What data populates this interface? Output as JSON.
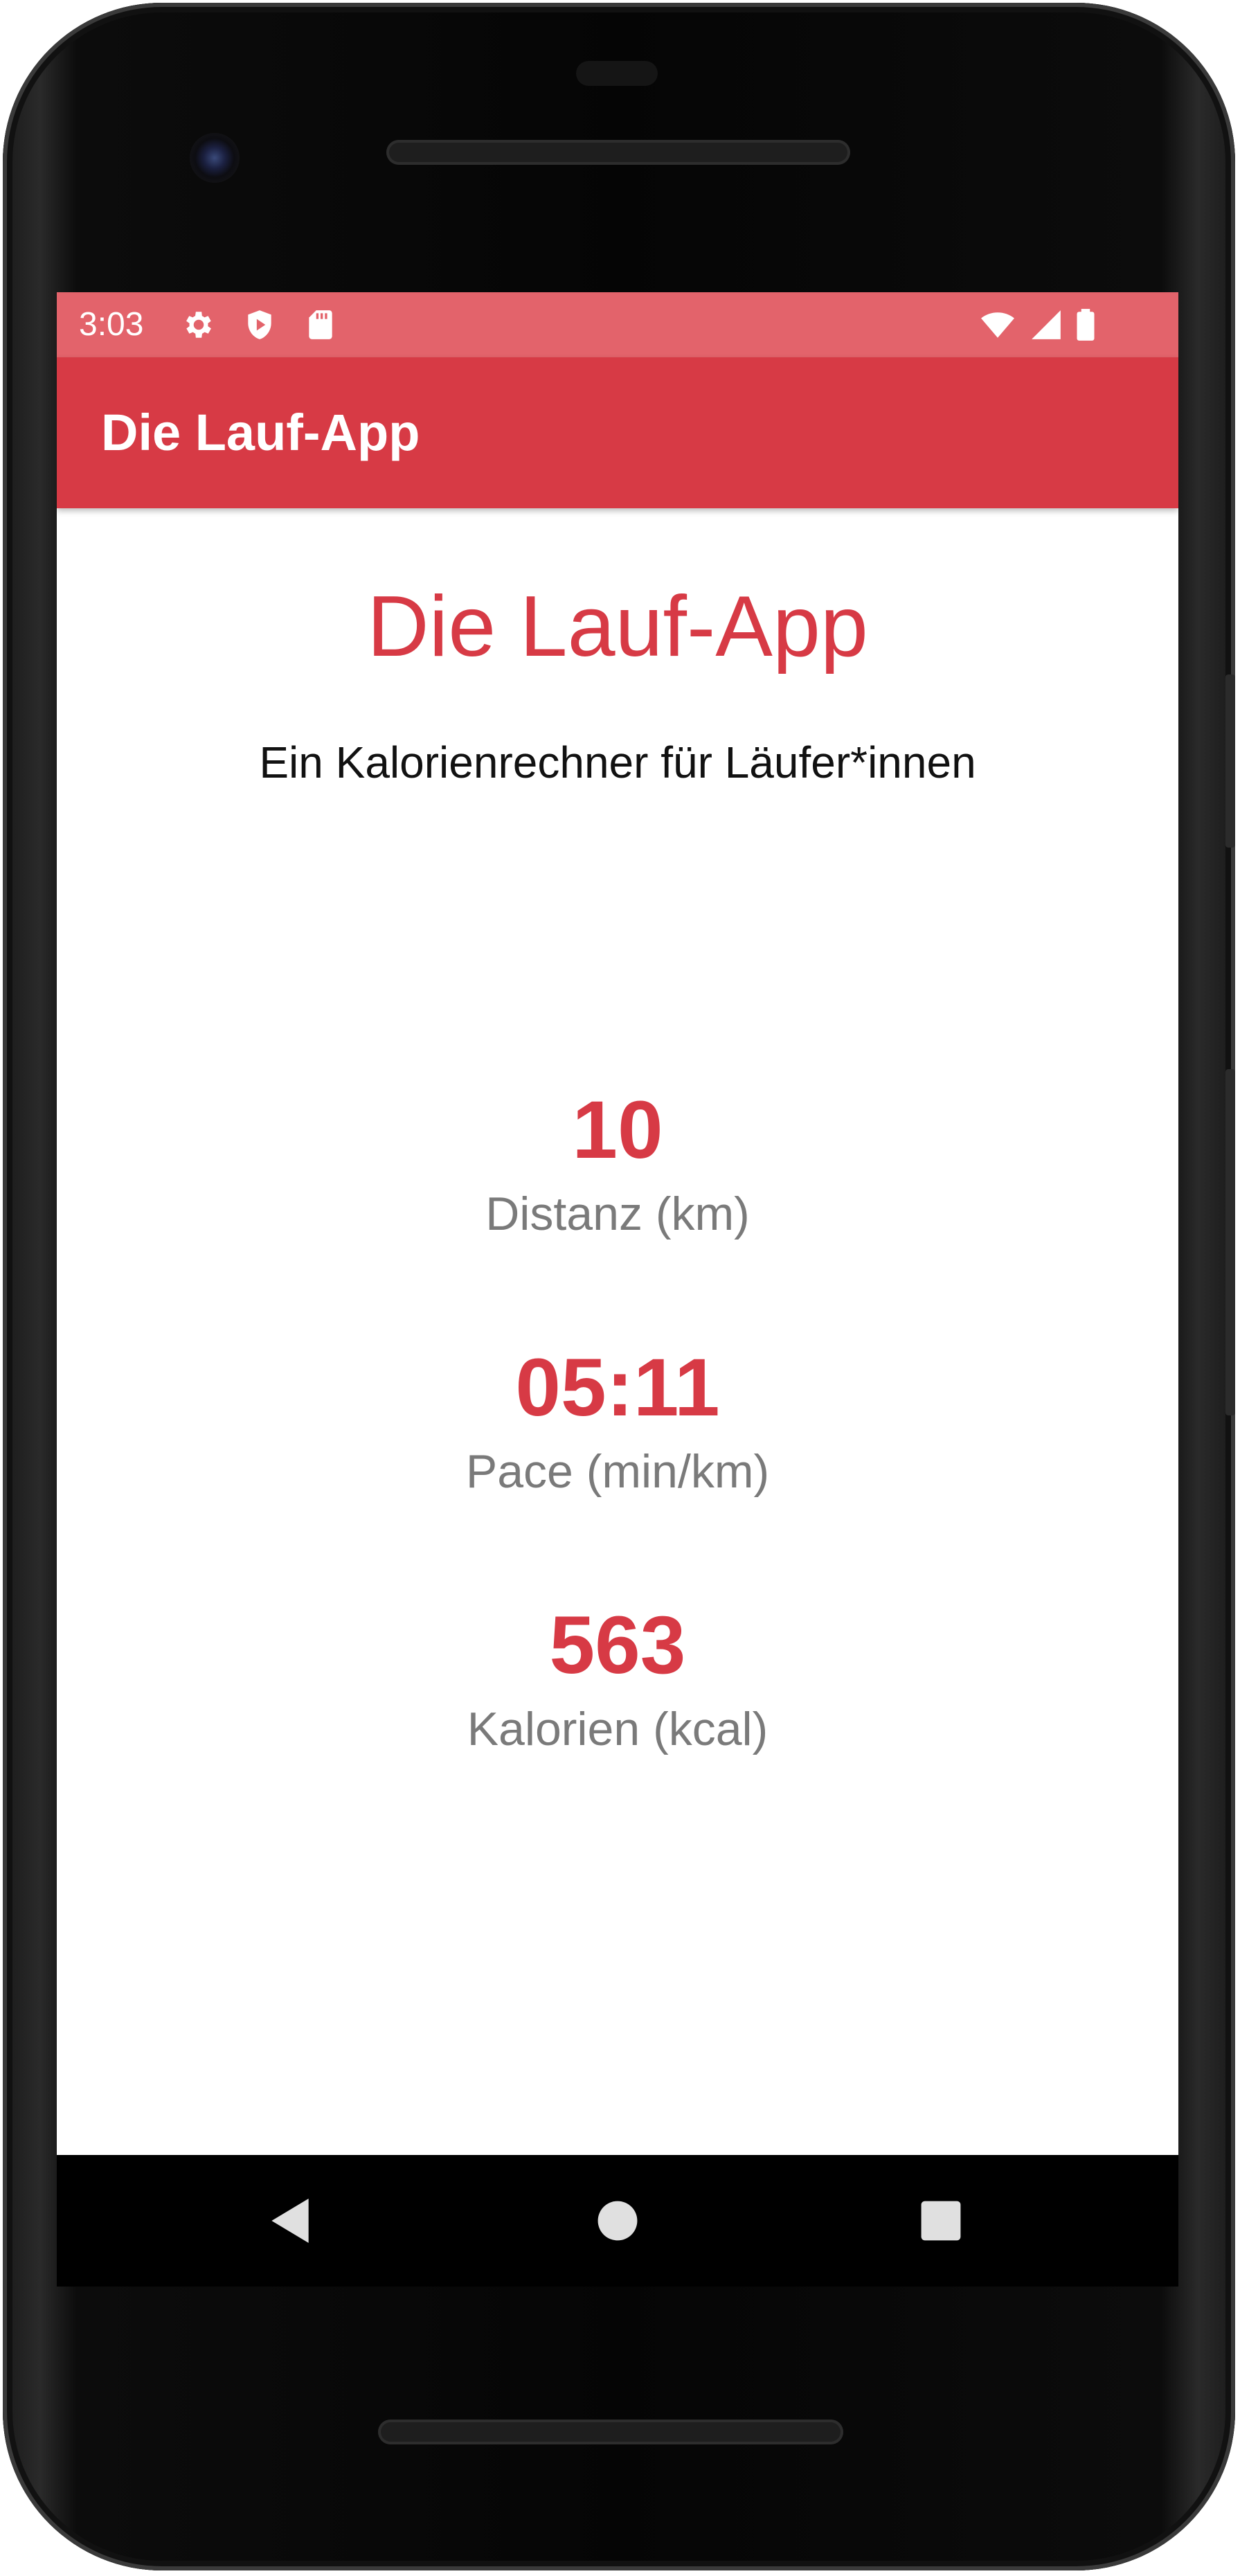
{
  "status_bar": {
    "time": "3:03",
    "left_icons": [
      "settings-gear-icon",
      "shield-play-icon",
      "sd-card-icon"
    ],
    "right_icons": [
      "wifi-icon",
      "cell-signal-icon",
      "battery-icon"
    ]
  },
  "app_bar": {
    "title": "Die Lauf-App"
  },
  "main": {
    "headline": "Die Lauf-App",
    "subtitle": "Ein Kalorienrechner für Läufer*innen",
    "stats": [
      {
        "value": "10",
        "label": "Distanz (km)"
      },
      {
        "value": "05:11",
        "label": "Pace (min/km)"
      },
      {
        "value": "563",
        "label": "Kalorien (kcal)"
      }
    ]
  },
  "navigation": {
    "buttons": [
      "back-icon",
      "home-icon",
      "recents-icon"
    ]
  },
  "colors": {
    "primary": "#d73a45",
    "status_bar": "#e3636b",
    "label_gray": "#7a7a7a"
  }
}
